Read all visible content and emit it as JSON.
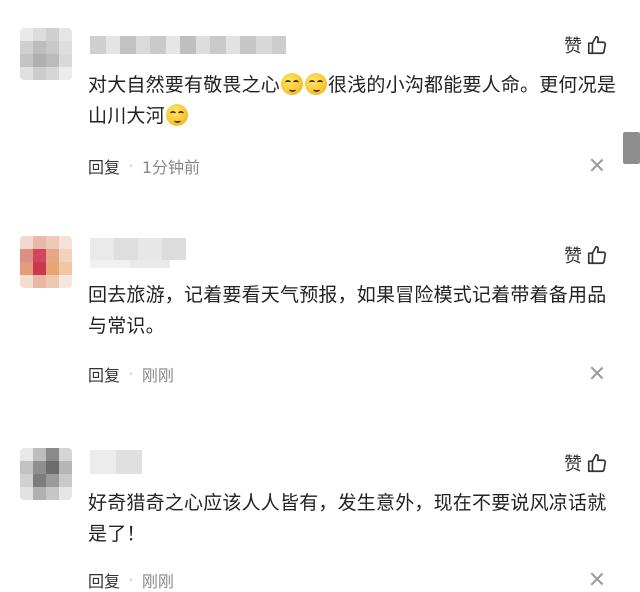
{
  "like_label": "赞",
  "comments": [
    {
      "text_parts": [
        "对大自然要有敬畏之心",
        "很浅的小沟都能要人命。更何况是山川大河"
      ],
      "reply_label": "回复",
      "time": "1分钟前"
    },
    {
      "text": "回去旅游，记着要看天气预报，如果冒险模式记着带着备用品与常识。",
      "reply_label": "回复",
      "time": "刚刚"
    },
    {
      "text": "好奇猎奇之心应该人人皆有，发生意外，现在不要说风凉话就是了！",
      "reply_label": "回复",
      "time": "刚刚"
    }
  ],
  "emoji": "smirk-emoji",
  "colors": {
    "text": "#222222",
    "meta": "#888888",
    "scrollbar": "#8e8e8e"
  }
}
